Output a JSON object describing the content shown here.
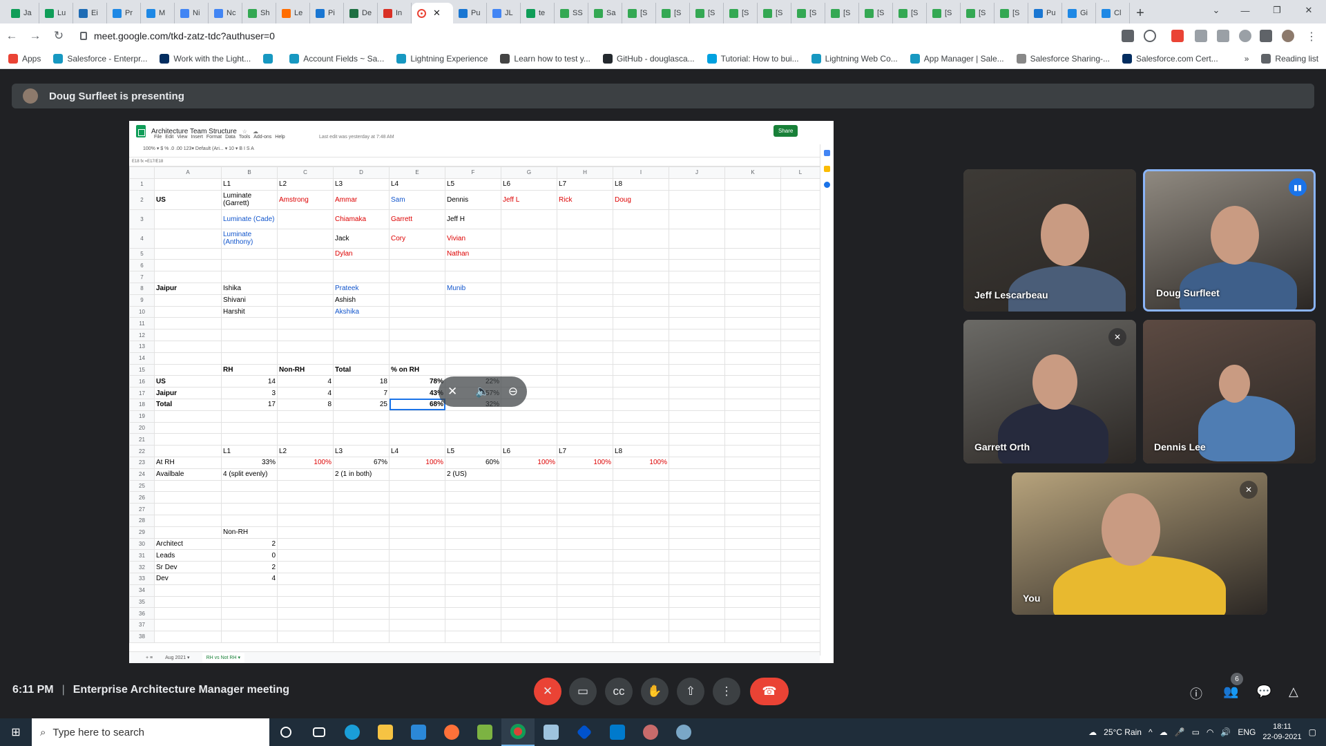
{
  "browser": {
    "tabs": [
      {
        "label": "Ja",
        "color": "#0f9d58"
      },
      {
        "label": "Lu",
        "color": "#0f9d58"
      },
      {
        "label": "Ei",
        "color": "#1f6cb5"
      },
      {
        "label": "Pr",
        "color": "#1e88e5"
      },
      {
        "label": "M",
        "color": "#1e88e5"
      },
      {
        "label": "Ni",
        "color": "#4285f4"
      },
      {
        "label": "Nc",
        "color": "#4285f4"
      },
      {
        "label": "Sh",
        "color": "#34a853"
      },
      {
        "label": "Le",
        "color": "#ff6d00"
      },
      {
        "label": "Pi",
        "color": "#1976d2"
      },
      {
        "label": "De",
        "color": "#1d6f42"
      },
      {
        "label": "In",
        "color": "#d93025"
      },
      {
        "label": "",
        "color": "#ea4335",
        "active": true
      },
      {
        "label": "Pu",
        "color": "#1976d2"
      },
      {
        "label": "JL",
        "color": "#4285f4"
      },
      {
        "label": "te",
        "color": "#0f9d58"
      },
      {
        "label": "SS",
        "color": "#34a853"
      },
      {
        "label": "Sa",
        "color": "#34a853"
      },
      {
        "label": "[S",
        "color": "#34a853"
      },
      {
        "label": "[S",
        "color": "#34a853"
      },
      {
        "label": "[S",
        "color": "#34a853"
      },
      {
        "label": "[S",
        "color": "#34a853"
      },
      {
        "label": "[S",
        "color": "#34a853"
      },
      {
        "label": "[S",
        "color": "#34a853"
      },
      {
        "label": "[S",
        "color": "#34a853"
      },
      {
        "label": "[S",
        "color": "#34a853"
      },
      {
        "label": "[S",
        "color": "#34a853"
      },
      {
        "label": "[S",
        "color": "#34a853"
      },
      {
        "label": "[S",
        "color": "#34a853"
      },
      {
        "label": "[S",
        "color": "#34a853"
      },
      {
        "label": "Pu",
        "color": "#1976d2"
      },
      {
        "label": "Gi",
        "color": "#1e88e5"
      },
      {
        "label": "Cl",
        "color": "#1e88e5"
      }
    ],
    "url": "meet.google.com/tkd-zatz-tdc?authuser=0",
    "bookmarks": [
      {
        "label": "Apps",
        "color": "#ea4335"
      },
      {
        "label": "Salesforce - Enterpr...",
        "color": "#1798c1"
      },
      {
        "label": "Work with the Light...",
        "color": "#032d60"
      },
      {
        "label": "",
        "color": "#1798c1"
      },
      {
        "label": "Account Fields ~ Sa...",
        "color": "#1798c1"
      },
      {
        "label": "Lightning Experience",
        "color": "#1798c1"
      },
      {
        "label": "Learn how to test y...",
        "color": "#444"
      },
      {
        "label": "GitHub - douglasca...",
        "color": "#24292e"
      },
      {
        "label": "Tutorial: How to bui...",
        "color": "#00a1e0"
      },
      {
        "label": "Lightning Web Co...",
        "color": "#1798c1"
      },
      {
        "label": "App Manager | Sale...",
        "color": "#1798c1"
      },
      {
        "label": "Salesforce Sharing-...",
        "color": "#888"
      },
      {
        "label": "Salesforce.com Cert...",
        "color": "#032d60"
      },
      {
        "label": "»",
        "color": "transparent"
      },
      {
        "label": "Reading list",
        "color": "#5f6368"
      }
    ]
  },
  "meet": {
    "presenting": "Doug Surfleet is presenting",
    "time": "6:11 PM",
    "sep": "|",
    "meeting_title": "Enterprise Architecture Manager meeting",
    "participant_count": "6",
    "participants": [
      {
        "name": "Jeff Lescarbeau",
        "bg": "#3d3a36",
        "shirt": "#4a5d78"
      },
      {
        "name": "Doug Surfleet",
        "bg": "#8f8980",
        "shirt": "#3e5f8a",
        "speaking": true
      },
      {
        "name": "Garrett Orth",
        "bg": "#6b6a66",
        "shirt": "#262a3d",
        "muted": true
      },
      {
        "name": "Dennis Lee",
        "bg": "#5c4a42",
        "shirt": "#4f7db3"
      },
      {
        "name": "You",
        "bg": "#b7a37c",
        "shirt": "#e8b92f",
        "muted": true
      }
    ]
  },
  "sheet": {
    "title": "Architecture Team Structure",
    "menus": [
      "File",
      "Edit",
      "View",
      "Insert",
      "Format",
      "Data",
      "Tools",
      "Add-ons",
      "Help"
    ],
    "last_edit": "Last edit was yesterday at 7:48 AM",
    "share": "Share",
    "toolbar": "100% ▾   $  %  .0  .00  123▾   Default (Ari... ▾   10 ▾   B  I  S  A",
    "formula": "E18   fx   =E17/E18",
    "col_headers": [
      "",
      "A",
      "B",
      "C",
      "D",
      "E",
      "F",
      "G",
      "H",
      "I",
      "J",
      "K",
      "L"
    ],
    "rows": [
      [
        "1",
        "",
        "L1",
        "L2",
        "L3",
        "L4",
        "L5",
        "L6",
        "L7",
        "L8",
        "",
        "",
        ""
      ],
      [
        "2",
        "US",
        "Luminate (Garrett)",
        "Amstrong",
        "Ammar",
        "Sam",
        "Dennis",
        "Jeff L",
        "Rick",
        "Doug",
        "",
        "",
        ""
      ],
      [
        "3",
        "",
        "Luminate (Cade)",
        "",
        "Chiamaka",
        "Garrett",
        "Jeff H",
        "",
        "",
        "",
        "",
        "",
        ""
      ],
      [
        "4",
        "",
        "Luminate (Anthony)",
        "",
        "Jack",
        "Cory",
        "Vivian",
        "",
        "",
        "",
        "",
        "",
        ""
      ],
      [
        "5",
        "",
        "",
        "",
        "Dylan",
        "",
        "Nathan",
        "",
        "",
        "",
        "",
        "",
        ""
      ],
      [
        "6",
        "",
        "",
        "",
        "",
        "",
        "",
        "",
        "",
        "",
        "",
        "",
        ""
      ],
      [
        "7",
        "",
        "",
        "",
        "",
        "",
        "",
        "",
        "",
        "",
        "",
        "",
        ""
      ],
      [
        "8",
        "Jaipur",
        "Ishika",
        "",
        "Prateek",
        "",
        "Munib",
        "",
        "",
        "",
        "",
        "",
        ""
      ],
      [
        "9",
        "",
        "Shivani",
        "",
        "Ashish",
        "",
        "",
        "",
        "",
        "",
        "",
        "",
        ""
      ],
      [
        "10",
        "",
        "Harshit",
        "",
        "Akshika",
        "",
        "",
        "",
        "",
        "",
        "",
        "",
        ""
      ],
      [
        "11",
        "",
        "",
        "",
        "",
        "",
        "",
        "",
        "",
        "",
        "",
        "",
        ""
      ],
      [
        "12",
        "",
        "",
        "",
        "",
        "",
        "",
        "",
        "",
        "",
        "",
        "",
        ""
      ],
      [
        "13",
        "",
        "",
        "",
        "",
        "",
        "",
        "",
        "",
        "",
        "",
        "",
        ""
      ],
      [
        "14",
        "",
        "",
        "",
        "",
        "",
        "",
        "",
        "",
        "",
        "",
        "",
        ""
      ],
      [
        "15",
        "",
        "RH",
        "Non-RH",
        "Total",
        "% on RH",
        "",
        "",
        "",
        "",
        "",
        "",
        ""
      ],
      [
        "16",
        "US",
        "14",
        "4",
        "18",
        "78%",
        "22%",
        "",
        "",
        "",
        "",
        "",
        ""
      ],
      [
        "17",
        "Jaipur",
        "3",
        "4",
        "7",
        "43%",
        "57%",
        "",
        "",
        "",
        "",
        "",
        ""
      ],
      [
        "18",
        "Total",
        "17",
        "8",
        "25",
        "68%",
        "32%",
        "",
        "",
        "",
        "",
        "",
        ""
      ],
      [
        "19",
        "",
        "",
        "",
        "",
        "",
        "",
        "",
        "",
        "",
        "",
        "",
        ""
      ],
      [
        "20",
        "",
        "",
        "",
        "",
        "",
        "",
        "",
        "",
        "",
        "",
        "",
        ""
      ],
      [
        "21",
        "",
        "",
        "",
        "",
        "",
        "",
        "",
        "",
        "",
        "",
        "",
        ""
      ],
      [
        "22",
        "",
        "L1",
        "L2",
        "L3",
        "L4",
        "L5",
        "L6",
        "L7",
        "L8",
        "",
        "",
        ""
      ],
      [
        "23",
        "At RH",
        "33%",
        "100%",
        "67%",
        "100%",
        "60%",
        "100%",
        "100%",
        "100%",
        "",
        "",
        ""
      ],
      [
        "24",
        "Availbale",
        "4 (split evenly)",
        "",
        "2 (1 in both)",
        "",
        "2 (US)",
        "",
        "",
        "",
        "",
        "",
        ""
      ],
      [
        "25",
        "",
        "",
        "",
        "",
        "",
        "",
        "",
        "",
        "",
        "",
        "",
        ""
      ],
      [
        "26",
        "",
        "",
        "",
        "",
        "",
        "",
        "",
        "",
        "",
        "",
        "",
        ""
      ],
      [
        "27",
        "",
        "",
        "",
        "",
        "",
        "",
        "",
        "",
        "",
        "",
        "",
        ""
      ],
      [
        "28",
        "",
        "",
        "",
        "",
        "",
        "",
        "",
        "",
        "",
        "",
        "",
        ""
      ],
      [
        "29",
        "",
        "Non-RH",
        "",
        "",
        "",
        "",
        "",
        "",
        "",
        "",
        "",
        ""
      ],
      [
        "30",
        "Architect",
        "2",
        "",
        "",
        "",
        "",
        "",
        "",
        "",
        "",
        "",
        ""
      ],
      [
        "31",
        "Leads",
        "0",
        "",
        "",
        "",
        "",
        "",
        "",
        "",
        "",
        "",
        ""
      ],
      [
        "32",
        "Sr Dev",
        "2",
        "",
        "",
        "",
        "",
        "",
        "",
        "",
        "",
        "",
        ""
      ],
      [
        "33",
        "Dev",
        "4",
        "",
        "",
        "",
        "",
        "",
        "",
        "",
        "",
        "",
        ""
      ],
      [
        "34",
        "",
        "",
        "",
        "",
        "",
        "",
        "",
        "",
        "",
        "",
        "",
        ""
      ],
      [
        "35",
        "",
        "",
        "",
        "",
        "",
        "",
        "",
        "",
        "",
        "",
        "",
        ""
      ],
      [
        "36",
        "",
        "",
        "",
        "",
        "",
        "",
        "",
        "",
        "",
        "",
        "",
        ""
      ],
      [
        "37",
        "",
        "",
        "",
        "",
        "",
        "",
        "",
        "",
        "",
        "",
        "",
        ""
      ],
      [
        "38",
        "",
        "",
        "",
        "",
        "",
        "",
        "",
        "",
        "",
        "",
        "",
        ""
      ]
    ],
    "tabs": [
      "Aug 2021 ▾",
      "RH vs Not RH ▾"
    ]
  },
  "taskbar": {
    "search_placeholder": "Type here to search",
    "weather": "25°C  Rain",
    "lang": "ENG",
    "time": "18:11",
    "date": "22-09-2021"
  }
}
